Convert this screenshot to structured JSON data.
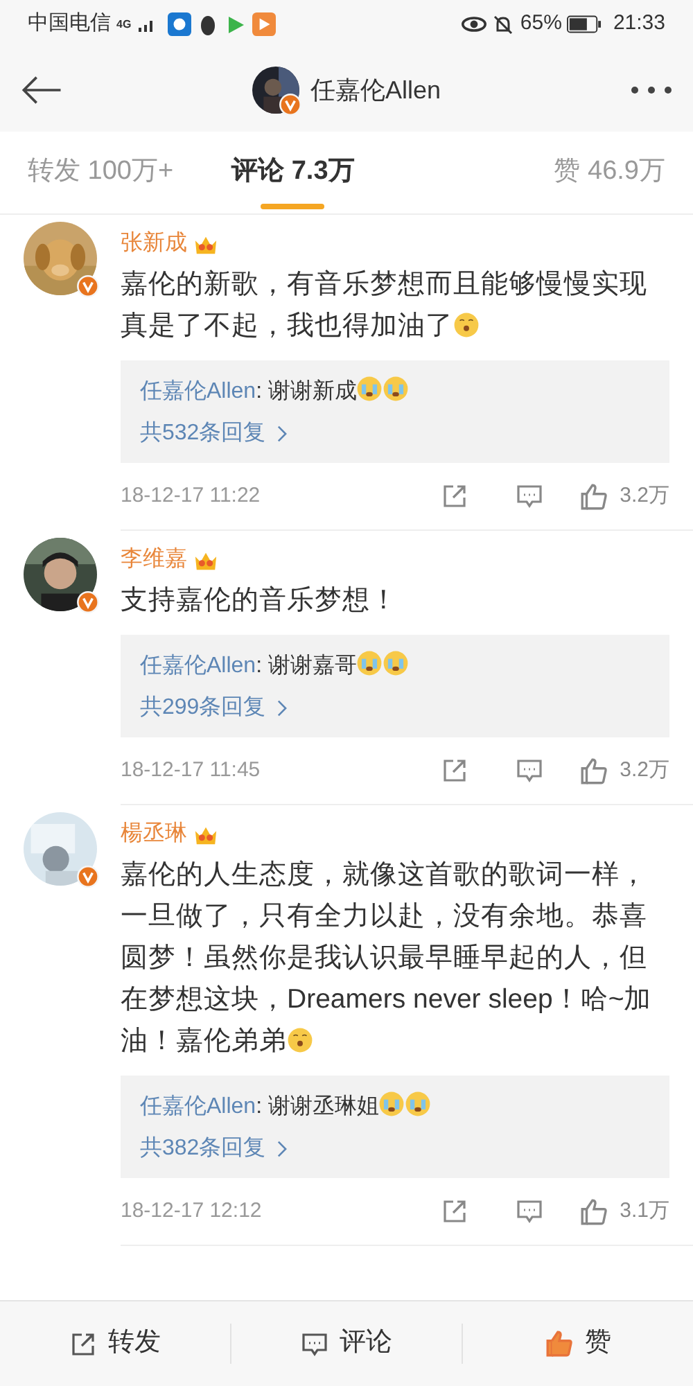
{
  "status_bar": {
    "carrier": "中国电信",
    "network": "4G",
    "battery": "65%",
    "time": "21:33"
  },
  "header": {
    "user": "任嘉伦Allen",
    "verified": true
  },
  "tabs": [
    {
      "label": "转发 100万+",
      "selected": false
    },
    {
      "label": "评论 7.3万",
      "selected": true
    },
    {
      "label": "赞 46.9万",
      "selected": false
    }
  ],
  "comments": [
    {
      "author": "张新成",
      "verified": true,
      "text": "嘉伦的新歌，有音乐梦想而且能够慢慢实现真是了不起，我也得加油了",
      "emoji": {
        "kind": "shy"
      },
      "reply": {
        "author": "任嘉伦Allen",
        "text": ": 谢谢新成",
        "emojis": [
          {
            "kind": "crying"
          },
          {
            "kind": "crying"
          }
        ],
        "more": "共532条回复"
      },
      "time": "18-12-17 11:22",
      "likes": "3.2万"
    },
    {
      "author": "李维嘉",
      "verified": true,
      "text": "支持嘉伦的音乐梦想！",
      "reply": {
        "author": "任嘉伦Allen",
        "text": ": 谢谢嘉哥",
        "emojis": [
          {
            "kind": "crying"
          },
          {
            "kind": "crying"
          }
        ],
        "more": "共299条回复"
      },
      "time": "18-12-17 11:45",
      "likes": "3.2万"
    },
    {
      "author": "楊丞琳",
      "verified": true,
      "text": "嘉伦的人生态度，就像这首歌的歌词一样，一旦做了，只有全力以赴，没有余地。恭喜圆梦！虽然你是我认识最早睡早起的人，但在梦想这块，Dreamers never sleep！哈~加油！嘉伦弟弟",
      "emoji": {
        "kind": "shy"
      },
      "reply": {
        "author": "任嘉伦Allen",
        "text": ": 谢谢丞琳姐",
        "emojis": [
          {
            "kind": "crying"
          },
          {
            "kind": "crying"
          }
        ],
        "more": "共382条回复"
      },
      "time": "18-12-17 12:12",
      "likes": "3.1万"
    }
  ],
  "bottom_bar": [
    {
      "kind": "share",
      "label": "转发"
    },
    {
      "kind": "comment",
      "label": "评论"
    },
    {
      "kind": "like",
      "label": "赞"
    }
  ]
}
